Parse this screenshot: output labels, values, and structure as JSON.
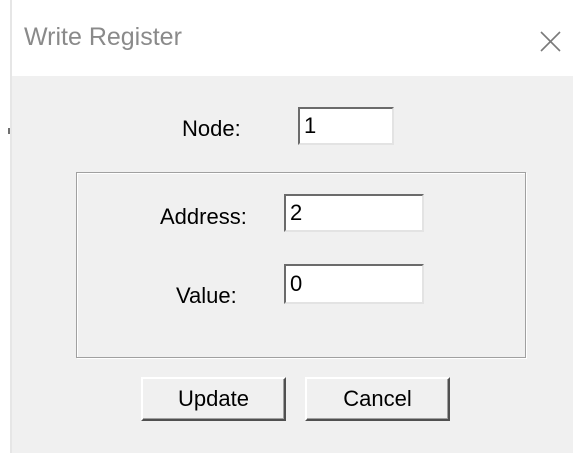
{
  "window": {
    "title": "Write Register",
    "close_icon": "close-icon"
  },
  "form": {
    "node_label": "Node:",
    "node_value": "1",
    "address_label": "Address:",
    "address_value": "2",
    "value_label": "Value:",
    "value_value": "0"
  },
  "buttons": {
    "update_label": "Update",
    "cancel_label": "Cancel"
  },
  "colors": {
    "title_text": "#8a8a8a",
    "client_background": "#f0f0f0",
    "titlebar_background": "#ffffff"
  }
}
